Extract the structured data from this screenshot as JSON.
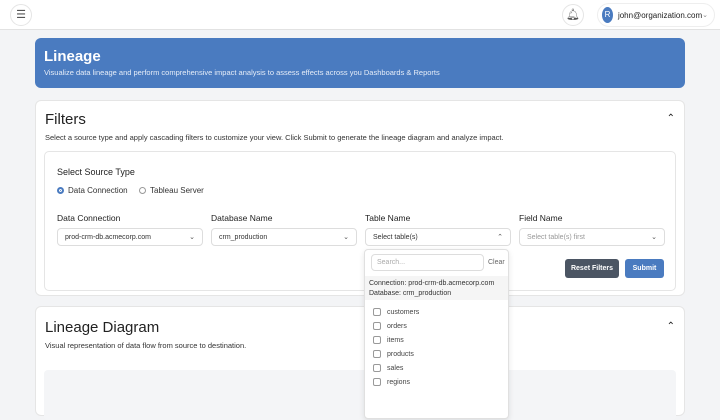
{
  "header": {
    "menu_icon": "menu-collapse-icon",
    "user_initial": "R",
    "user_email": "john@organization.com"
  },
  "banner": {
    "title": "Lineage",
    "subtitle": "Visualize data lineage and perform comprehensive impact analysis to assess effects across you Dashboards & Reports"
  },
  "filters": {
    "title": "Filters",
    "description": "Select a source type and apply cascading filters to customize your view. Click Submit to generate the lineage diagram and analyze impact.",
    "source_type_label": "Select Source Type",
    "source_options": [
      "Data Connection",
      "Tableau Server"
    ],
    "selected_source": "Data Connection",
    "fields": [
      {
        "label": "Data Connection",
        "value": "prod-crm-db.acmecorp.com"
      },
      {
        "label": "Database Name",
        "value": "crm_production"
      },
      {
        "label": "Table Name",
        "value": "Select table(s)"
      },
      {
        "label": "Field Name",
        "value": "Select table(s) first"
      }
    ],
    "reset_label": "Reset Filters",
    "submit_label": "Submit"
  },
  "dropdown": {
    "search_placeholder": "Search...",
    "clear_label": "Clear",
    "connection": "Connection: prod-crm-db.acmecorp.com",
    "database": "Database: crm_production",
    "tables": [
      "customers",
      "orders",
      "items",
      "products",
      "sales",
      "regions"
    ]
  },
  "diagram": {
    "title": "Lineage Diagram",
    "description": "Visual representation of data flow from source to destination."
  },
  "colors": {
    "primary": "#4a7bc0",
    "reset": "#4b5563"
  }
}
